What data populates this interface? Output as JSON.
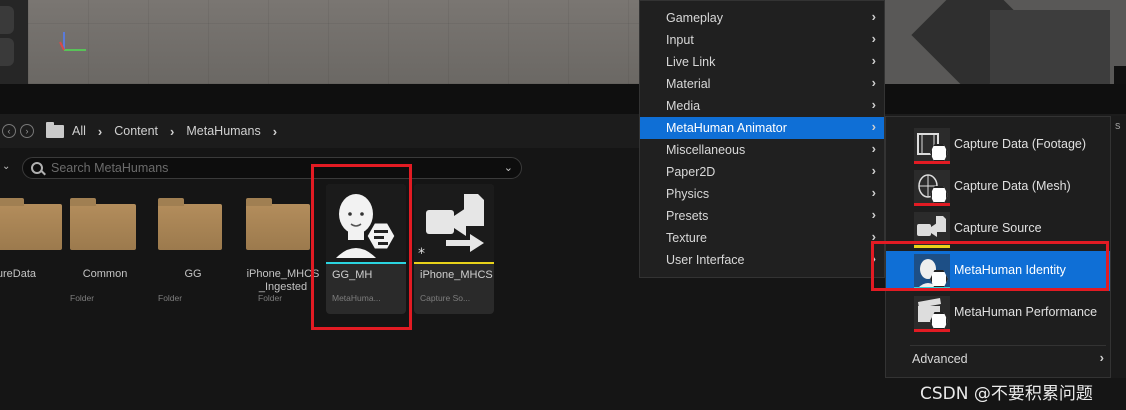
{
  "breadcrumb": {
    "items": [
      "All",
      "Content",
      "MetaHumans"
    ]
  },
  "search": {
    "placeholder": "Search MetaHumans"
  },
  "assets": [
    {
      "name": "ptureData",
      "type": "der"
    },
    {
      "name": "Common",
      "type": "Folder"
    },
    {
      "name": "GG",
      "type": "Folder"
    },
    {
      "name": "iPhone_MHCS\n_Ingested",
      "type": "Folder"
    },
    {
      "name": "GG_MH",
      "type": "MetaHuma..."
    },
    {
      "name": "iPhone_MHCS",
      "type": "Capture So..."
    }
  ],
  "menu": {
    "items": [
      {
        "label": "Gameplay"
      },
      {
        "label": "Input"
      },
      {
        "label": "Live Link"
      },
      {
        "label": "Material"
      },
      {
        "label": "Media"
      },
      {
        "label": "MetaHuman Animator"
      },
      {
        "label": "Miscellaneous"
      },
      {
        "label": "Paper2D"
      },
      {
        "label": "Physics"
      },
      {
        "label": "Presets"
      },
      {
        "label": "Texture"
      },
      {
        "label": "User Interface"
      }
    ],
    "active_index": 5
  },
  "submenu": {
    "items": [
      {
        "label": "Capture Data (Footage)",
        "icon": "capture-footage-icon",
        "underline": "#e21b23"
      },
      {
        "label": "Capture Data (Mesh)",
        "icon": "capture-mesh-icon",
        "underline": "#e21b23"
      },
      {
        "label": "Capture Source",
        "icon": "capture-source-icon",
        "underline": "#e8d21a"
      },
      {
        "label": "MetaHuman Identity",
        "icon": "metahuman-identity-icon",
        "underline": "#2bd4e0"
      },
      {
        "label": "MetaHuman Performance",
        "icon": "metahuman-performance-icon",
        "underline": "#e21b23"
      }
    ],
    "active_index": 3,
    "advanced_label": "Advanced"
  },
  "watermark": "CSDN @不要积累问题",
  "colors": {
    "highlight": "#0f6fd6",
    "annotation_red": "#e21b23",
    "folder": "#b38d5c"
  }
}
